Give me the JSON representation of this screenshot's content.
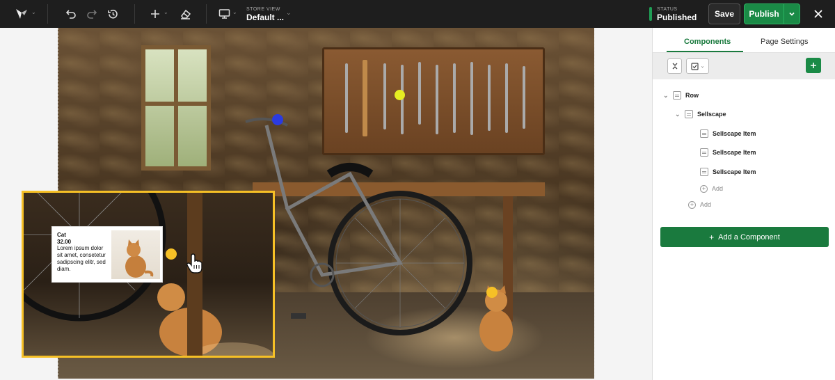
{
  "toolbar": {
    "store_view_label": "STORE VIEW",
    "store_view_value": "Default ...",
    "status_label": "STATUS",
    "status_value": "Published",
    "save_label": "Save",
    "publish_label": "Publish"
  },
  "canvas": {
    "product_card": {
      "name": "Cat",
      "price": "32.00",
      "description": "Lorem ipsum dolor sit amet, consetetur sadipscing elitr, sed diam."
    },
    "hotspot_colors": {
      "yellow": "#f6c026",
      "lime": "#e6ee22",
      "blue": "#2b3be0"
    }
  },
  "panel": {
    "tabs": {
      "components": "Components",
      "page_settings": "Page Settings"
    },
    "tree": {
      "row": "Row",
      "sellscape": "Sellscape",
      "items": [
        "Sellscape Item",
        "Sellscape Item",
        "Sellscape Item"
      ],
      "add_inner": "Add",
      "add_outer": "Add"
    },
    "add_component_label": "Add a Component"
  },
  "colors": {
    "accent": "#1a7a3e",
    "topbar": "#1e1e1e",
    "highlight": "#f6c026"
  }
}
